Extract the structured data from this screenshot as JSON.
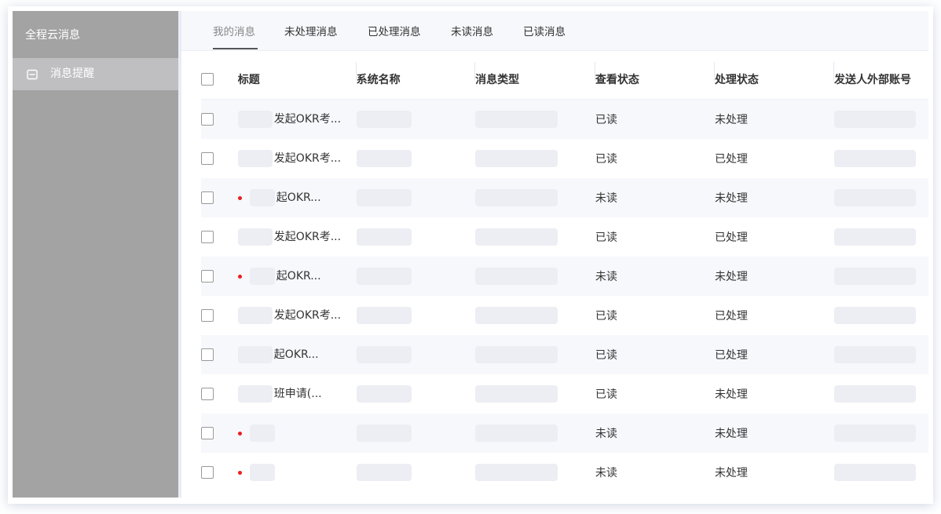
{
  "sidebar": {
    "title": "全程云消息",
    "items": [
      {
        "label": "消息提醒",
        "icon": "message-box-icon"
      }
    ]
  },
  "tabs": [
    {
      "label": "我的消息",
      "active": true
    },
    {
      "label": "未处理消息"
    },
    {
      "label": "已处理消息"
    },
    {
      "label": "未读消息"
    },
    {
      "label": "已读消息"
    }
  ],
  "table": {
    "columns": [
      "标题",
      "系统名称",
      "消息类型",
      "查看状态",
      "处理状态",
      "发送人外部账号"
    ],
    "rows": [
      {
        "title": "发起OKR考...",
        "view": "已读",
        "process": "未处理",
        "unread": false
      },
      {
        "title": "发起OKR考...",
        "view": "已读",
        "process": "已处理",
        "unread": false
      },
      {
        "title": "起OKR...",
        "view": "未读",
        "process": "未处理",
        "unread": true
      },
      {
        "title": "发起OKR考...",
        "view": "已读",
        "process": "已处理",
        "unread": false
      },
      {
        "title": "起OKR...",
        "view": "未读",
        "process": "未处理",
        "unread": true
      },
      {
        "title": "发起OKR考...",
        "view": "已读",
        "process": "已处理",
        "unread": false
      },
      {
        "title": "起OKR...",
        "view": "已读",
        "process": "已处理",
        "unread": false
      },
      {
        "title": "班申请(...",
        "view": "已读",
        "process": "未处理",
        "unread": false
      },
      {
        "title": "",
        "view": "未读",
        "process": "未处理",
        "unread": true
      },
      {
        "title": "",
        "view": "未读",
        "process": "未处理",
        "unread": true
      }
    ]
  },
  "colors": {
    "sidebar_bg": "#a3a3a3",
    "sidebar_active": "#bfbfc1",
    "unread_dot": "#ee1c1c",
    "stripe": "#f7f8fc"
  }
}
